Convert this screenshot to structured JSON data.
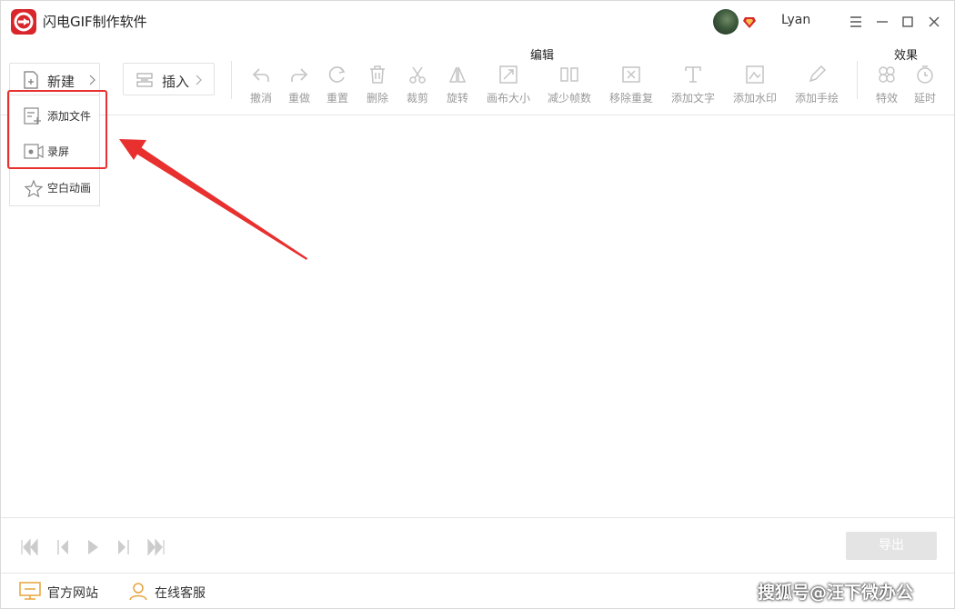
{
  "app": {
    "title": "闪电GIF制作软件",
    "username": "Lyan"
  },
  "toolbar": {
    "new_label": "新建",
    "insert_label": "插入",
    "edit_group": "编辑",
    "effect_group": "效果",
    "tools": [
      {
        "label": "撤消",
        "icon": "undo-icon"
      },
      {
        "label": "重做",
        "icon": "redo-icon"
      },
      {
        "label": "重置",
        "icon": "reset-icon"
      },
      {
        "label": "删除",
        "icon": "trash-icon"
      },
      {
        "label": "裁剪",
        "icon": "scissors-icon"
      },
      {
        "label": "旋转",
        "icon": "flip-icon"
      },
      {
        "label": "画布大小",
        "icon": "resize-icon"
      },
      {
        "label": "减少帧数",
        "icon": "frames-icon"
      },
      {
        "label": "移除重复",
        "icon": "remove-duplicate-icon"
      },
      {
        "label": "添加文字",
        "icon": "text-icon"
      },
      {
        "label": "添加水印",
        "icon": "watermark-icon"
      },
      {
        "label": "添加手绘",
        "icon": "pen-icon"
      },
      {
        "label": "特效",
        "icon": "effects-icon"
      },
      {
        "label": "延时",
        "icon": "timer-icon"
      }
    ]
  },
  "dropdown": {
    "items": [
      {
        "label": "添加文件",
        "icon": "add-file-icon"
      },
      {
        "label": "录屏",
        "icon": "screen-record-icon"
      },
      {
        "label": "空白动画",
        "icon": "blank-animation-icon"
      }
    ]
  },
  "player": {
    "export_label": "导出"
  },
  "footer": {
    "website_label": "官方网站",
    "support_label": "在线客服",
    "watermark": "搜狐号@汪下微办公"
  },
  "colors": {
    "brand": "#d8262c",
    "highlight": "#e8302f",
    "disabled": "#b8b8b8",
    "footer_icon": "#e8a33d"
  }
}
